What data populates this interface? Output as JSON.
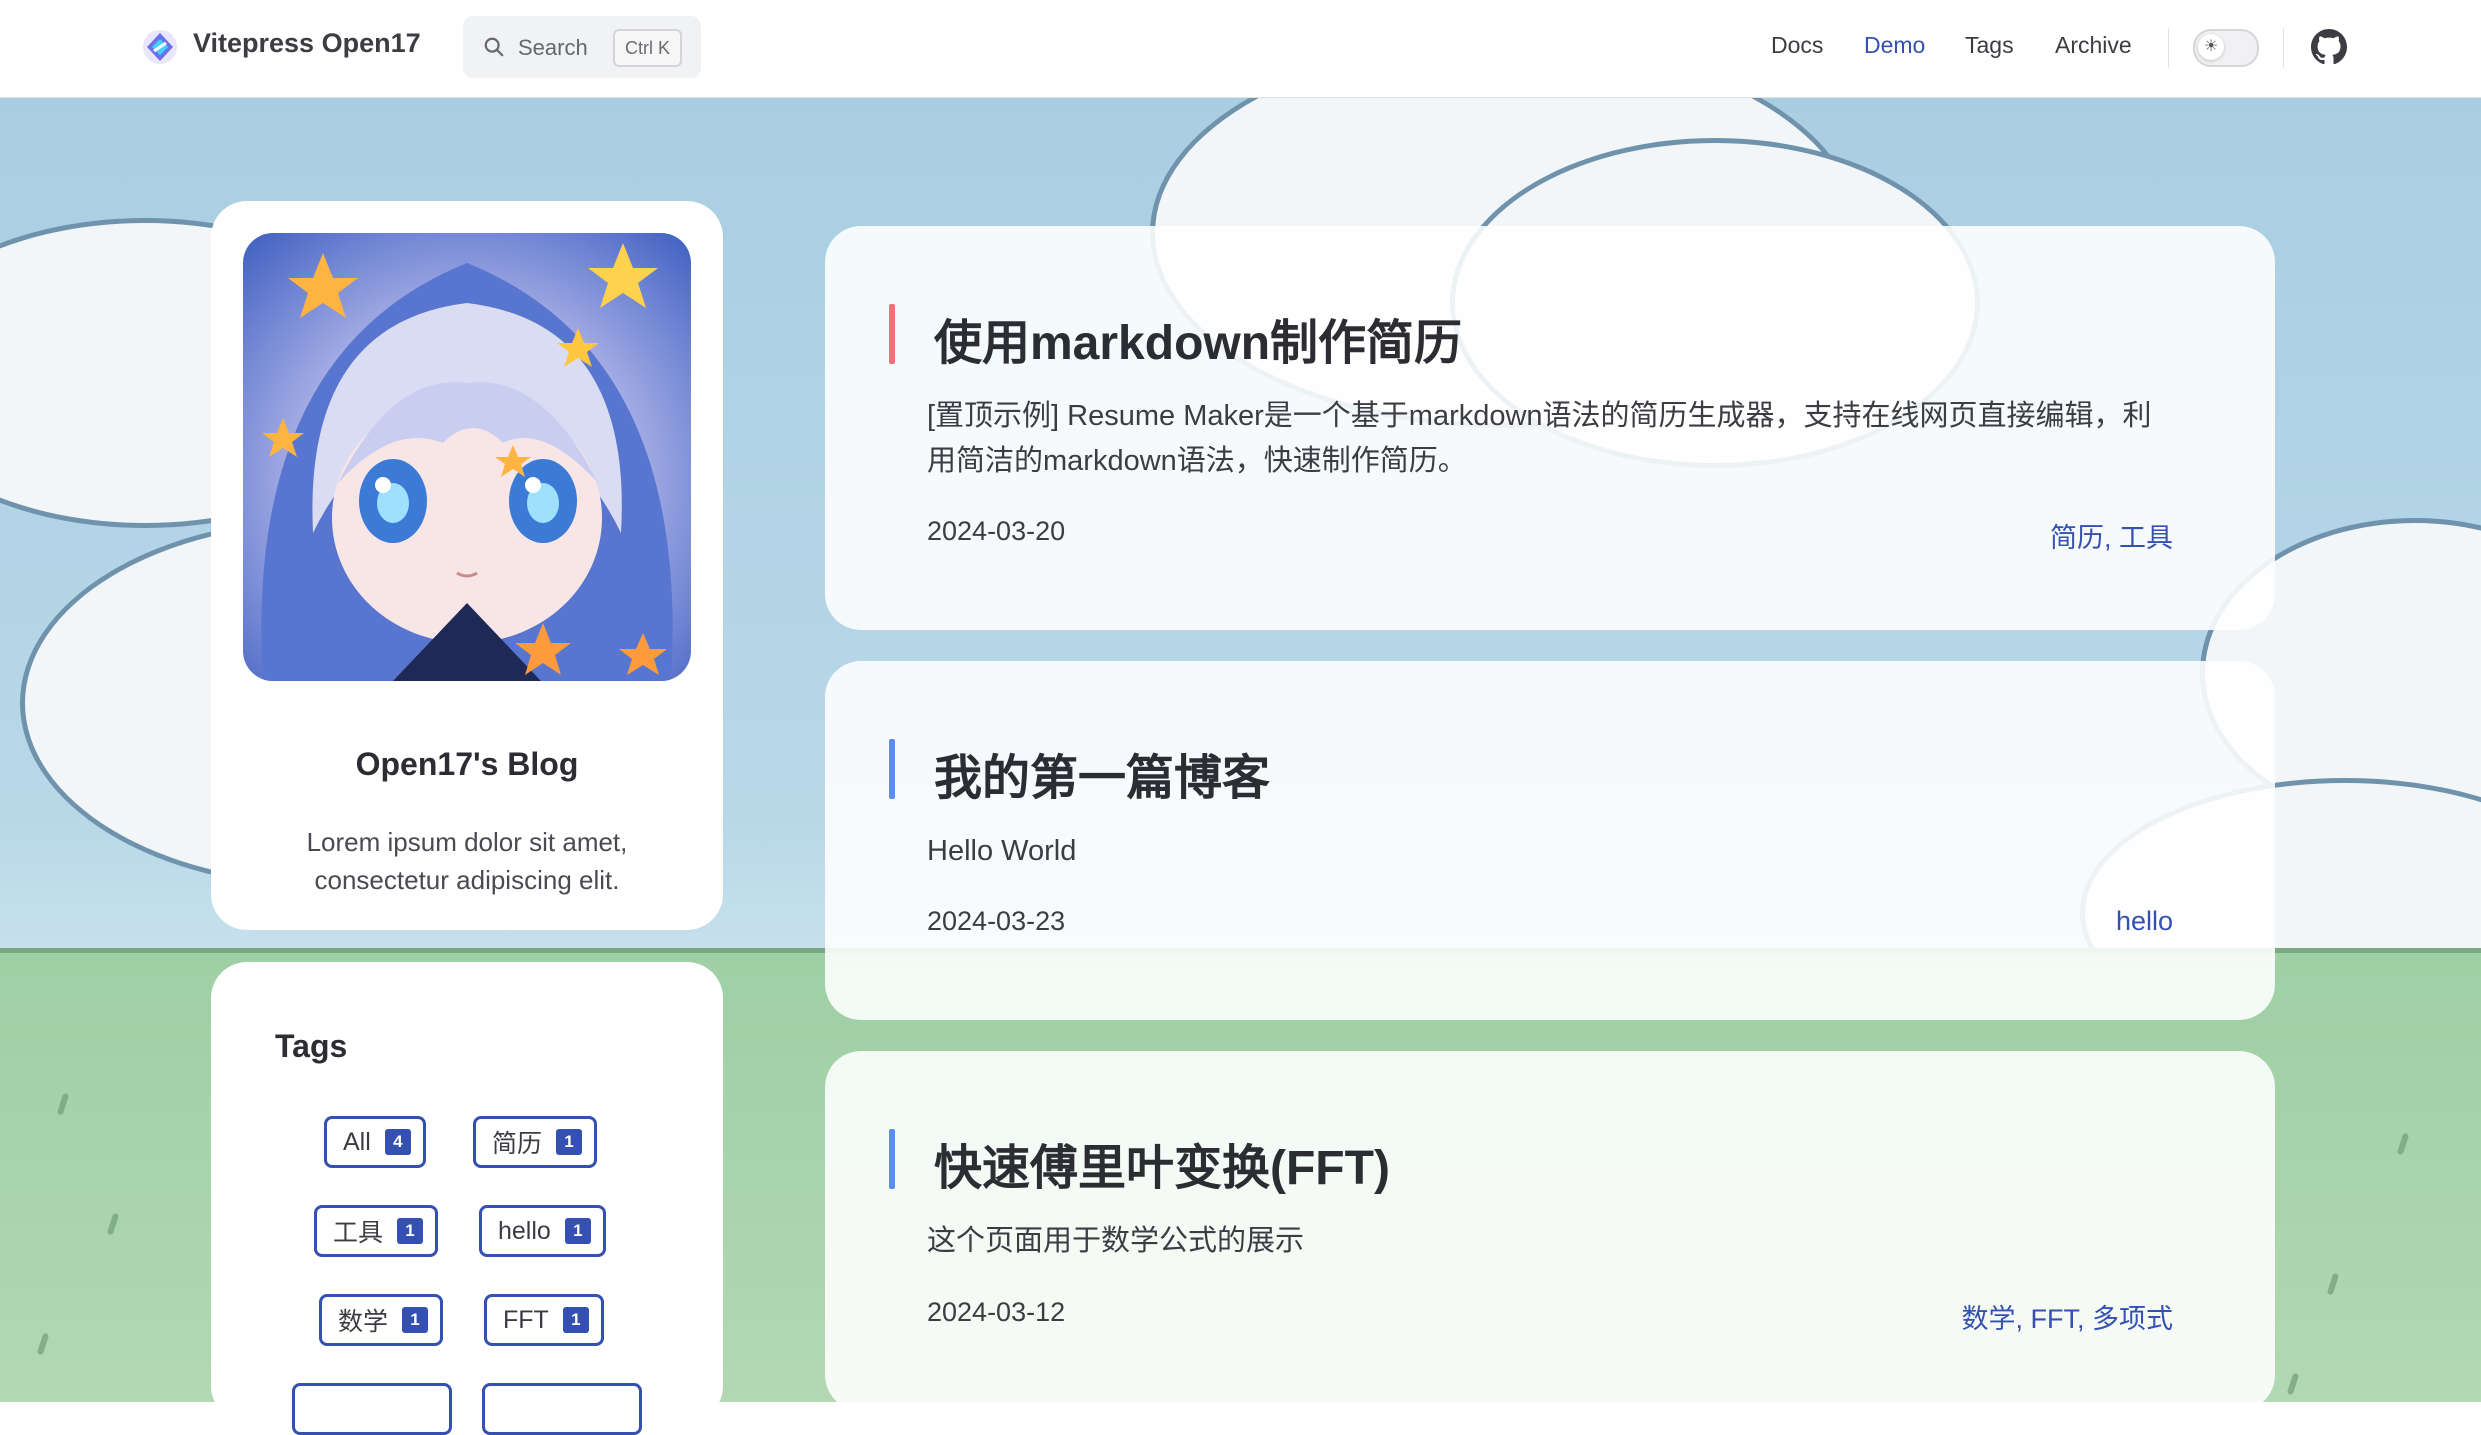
{
  "nav": {
    "site_title": "Vitepress Open17",
    "search": {
      "label": "Search",
      "shortcut": "Ctrl K"
    },
    "links": [
      {
        "label": "Docs",
        "active": false
      },
      {
        "label": "Demo",
        "active": true
      },
      {
        "label": "Tags",
        "active": false
      },
      {
        "label": "Archive",
        "active": false
      }
    ],
    "icons": {
      "logo": "vitepress-logo-icon",
      "search": "search-icon",
      "theme_toggle": "sun-icon",
      "github": "github-icon"
    }
  },
  "profile": {
    "blog_name": "Open17's Blog",
    "description": "Lorem ipsum dolor sit amet, consectetur adipiscing elit."
  },
  "tags_card": {
    "title": "Tags",
    "tags": [
      {
        "name": "All",
        "count": "4"
      },
      {
        "name": "简历",
        "count": "1"
      },
      {
        "name": "工具",
        "count": "1"
      },
      {
        "name": "hello",
        "count": "1"
      },
      {
        "name": "数学",
        "count": "1"
      },
      {
        "name": "FFT",
        "count": "1"
      }
    ]
  },
  "posts": [
    {
      "title": "使用markdown制作简历",
      "excerpt": "[置顶示例] Resume Maker是一个基于markdown语法的简历生成器，支持在线网页直接编辑，利用简洁的markdown语法，快速制作简历。",
      "date": "2024-03-20",
      "tags": "简历, 工具",
      "accent": "#f07178"
    },
    {
      "title": "我的第一篇博客",
      "excerpt": "Hello World",
      "date": "2024-03-23",
      "tags": "hello",
      "accent": "#5b8def"
    },
    {
      "title": "快速傅里叶变换(FFT)",
      "excerpt": "这个页面用于数学公式的展示",
      "date": "2024-03-12",
      "tags": "数学, FFT, 多项式",
      "accent": "#5b8def"
    }
  ],
  "colors": {
    "brand": "#3451b2",
    "sky": "#a9cee2",
    "grass": "#a6d3aa"
  }
}
